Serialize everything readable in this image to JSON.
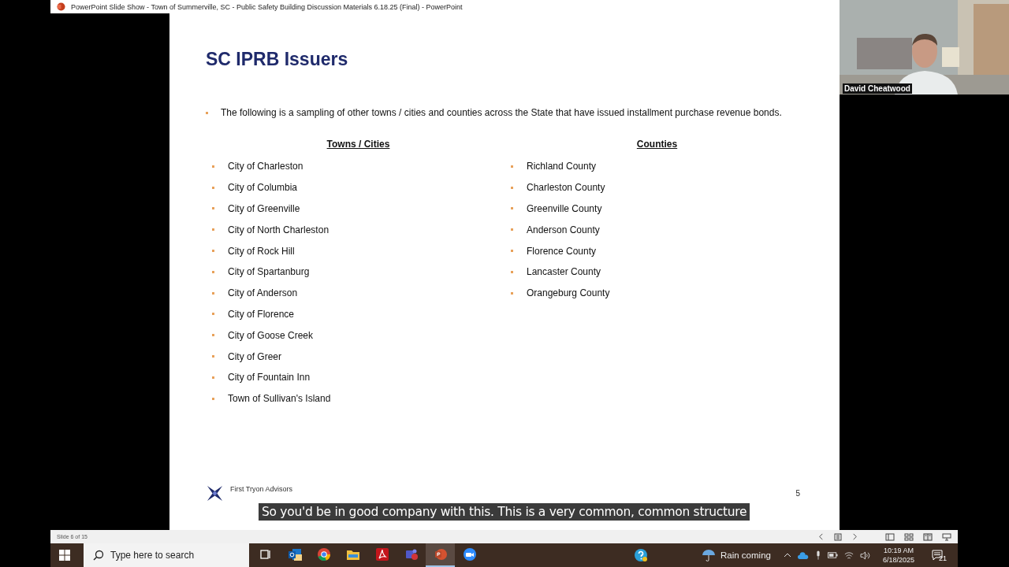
{
  "window": {
    "title": "PowerPoint Slide Show  -  Town of Summerville, SC - Public Safety Building Discussion Materials 6.18.25 (Final) - PowerPoint"
  },
  "slide": {
    "title": "SC IPRB Issuers",
    "intro": "The following is a sampling of other towns / cities and counties across the State that have issued installment purchase revenue bonds.",
    "columns": [
      {
        "heading": "Towns / Cities",
        "items": [
          "City of Charleston",
          "City of Columbia",
          "City of Greenville",
          "City of North Charleston",
          "City of Rock Hill",
          "City of Spartanburg",
          "City of Anderson",
          "City of Florence",
          "City of Goose Creek",
          "City of Greer",
          "City of Fountain Inn",
          "Town of Sullivan's Island"
        ]
      },
      {
        "heading": "Counties",
        "items": [
          "Richland County",
          "Charleston County",
          "Greenville County",
          "Anderson County",
          "Florence County",
          "Lancaster County",
          "Orangeburg County"
        ]
      }
    ],
    "footer": {
      "company": "First Tryon Advisors",
      "page_number": "5"
    }
  },
  "caption": "So you'd be in good company with this. This is a very common, common structure",
  "participant": {
    "name": "David Cheatwood"
  },
  "status_bar": {
    "slide_indicator": "Slide 6 of 15"
  },
  "taskbar": {
    "search": {
      "placeholder": "Type here to search"
    },
    "apps": [
      {
        "kind": "taskview",
        "selected": false
      },
      {
        "kind": "outlook",
        "selected": false
      },
      {
        "kind": "chrome",
        "selected": false
      },
      {
        "kind": "explorer",
        "selected": false
      },
      {
        "kind": "acrobat",
        "selected": false
      },
      {
        "kind": "teams",
        "selected": false
      },
      {
        "kind": "powerpoint",
        "selected": true
      },
      {
        "kind": "zoom",
        "selected": false
      }
    ],
    "weather": "Rain coming",
    "time": "10:19 AM",
    "date": "6/18/2025",
    "notifications": "21"
  }
}
